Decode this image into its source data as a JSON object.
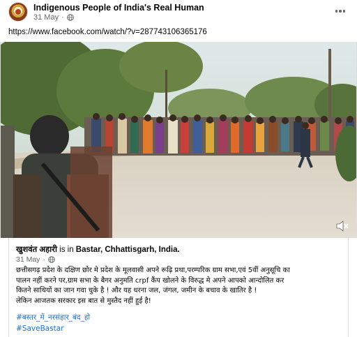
{
  "post": {
    "page_name": "Indigenous People of India's Real Human",
    "date": "31 May",
    "separator": "·",
    "privacy_icon": "globe-icon",
    "more_icon": "ellipsis-icon",
    "link_text": "https://www.facebook.com/watch/?v=287743106365176"
  },
  "video": {
    "mute_icon": "speaker-muted-icon"
  },
  "shared": {
    "author_name": "खुशवंत अहारी",
    "is_in": "is in",
    "location": "Bastar, Chhattisgarh, India.",
    "date": "31 May",
    "separator": "·",
    "privacy_icon": "globe-icon",
    "body_lines": [
      "छत्तीसगढ़ प्रदेश के दक्षिण छोर मे प्रदेश के मूलवासी अपने रूढ़ि प्रथा,परम्परिक ग्राम सभा,एवं 5वीं अनुसूचि का",
      "पालन नहीं करने पर,ग्राम सभा के बैगर अनुमति crpf कैंप खोलने के विरुद्ध मे अपने आपको आन्दोलित कर",
      "कितने साथियों का जान गवा चुके है ! और यह धरना जल, जंगल, जमीन के बचाव के खातिर है !",
      "लेकिन आजतक सरकार इस बात से मुस्तैद नहीं हुई है!"
    ],
    "hashtags": [
      "#बस्तर_में_नरसंहार_बंद_हो",
      "#SaveBastar"
    ]
  },
  "colors": {
    "link_blue": "#216fdb",
    "meta_gray": "#65676b",
    "text": "#050505"
  }
}
